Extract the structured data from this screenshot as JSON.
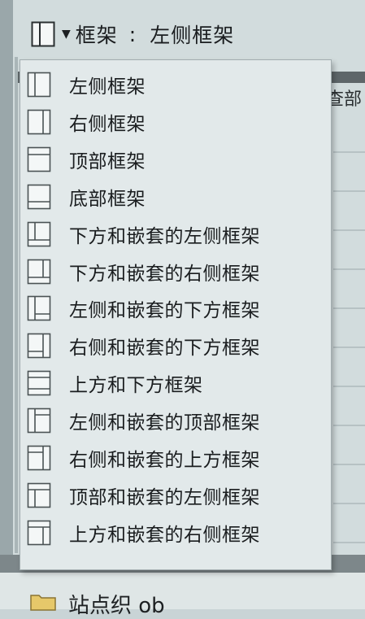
{
  "toolbar": {
    "selector_prefix": "框架",
    "selector_separator": ":",
    "selector_value": "左侧框架",
    "icon": "left-frame-layout-icon"
  },
  "frame_menu": {
    "items": [
      {
        "label": "左侧框架",
        "icon": "left-frame-icon"
      },
      {
        "label": "右侧框架",
        "icon": "right-frame-icon"
      },
      {
        "label": "顶部框架",
        "icon": "top-frame-icon"
      },
      {
        "label": "底部框架",
        "icon": "bottom-frame-icon"
      },
      {
        "label": "下方和嵌套的左侧框架",
        "icon": "bottom-nested-left-frame-icon"
      },
      {
        "label": "下方和嵌套的右侧框架",
        "icon": "bottom-nested-right-frame-icon"
      },
      {
        "label": "左侧和嵌套的下方框架",
        "icon": "left-nested-bottom-frame-icon"
      },
      {
        "label": "右侧和嵌套的下方框架",
        "icon": "right-nested-bottom-frame-icon"
      },
      {
        "label": "上方和下方框架",
        "icon": "top-and-bottom-frame-icon"
      },
      {
        "label": "左侧和嵌套的顶部框架",
        "icon": "left-nested-top-frame-icon"
      },
      {
        "label": "右侧和嵌套的上方框架",
        "icon": "right-nested-top-frame-icon"
      },
      {
        "label": "顶部和嵌套的左侧框架",
        "icon": "top-nested-left-frame-icon"
      },
      {
        "label": "上方和嵌套的右侧框架",
        "icon": "top-nested-right-frame-icon"
      }
    ]
  },
  "background": {
    "side_text": "查部",
    "bottom_text": "站点织 ob",
    "bottom_icon": "folder-icon"
  },
  "colors": {
    "menu_background": "#e2e9ea",
    "menu_border": "#a2adaf",
    "text": "#1a1d1f",
    "icon_stroke": "#4a5254"
  }
}
